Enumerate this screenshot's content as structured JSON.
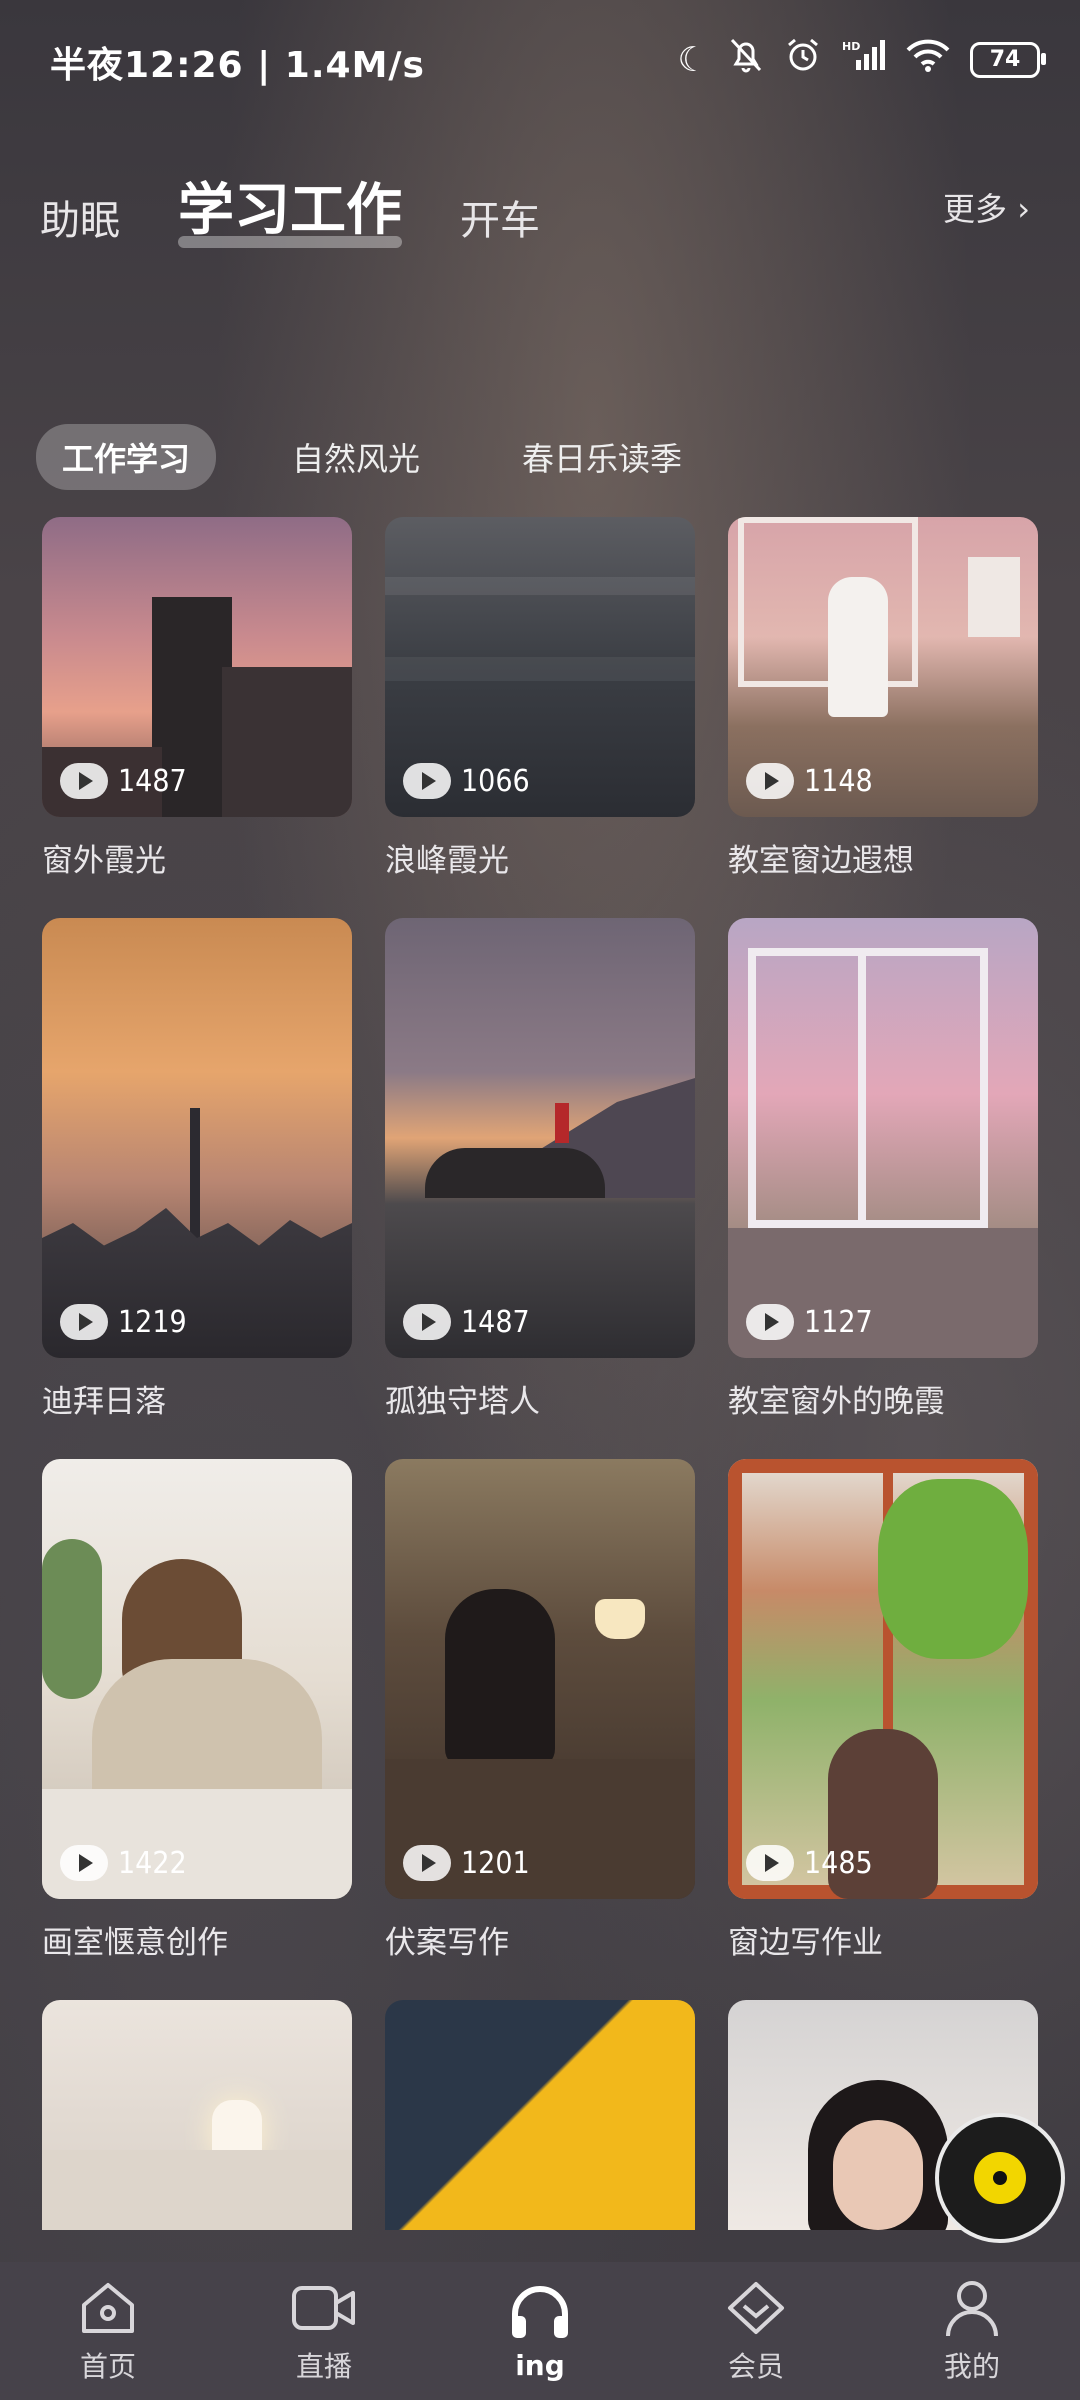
{
  "status_bar": {
    "time": "半夜12:26 | 1.4M/s",
    "battery": "74",
    "icons": [
      "moon-icon",
      "bell-off-icon",
      "alarm-icon",
      "signal-icon",
      "wifi-icon",
      "battery-icon"
    ]
  },
  "top_tabs": [
    {
      "label": "助眠"
    },
    {
      "label": "学习工作"
    },
    {
      "label": "开车"
    }
  ],
  "more_label": "更多",
  "sub_tabs": [
    {
      "label": "工作学习"
    },
    {
      "label": "自然风光"
    },
    {
      "label": "春日乐读季"
    }
  ],
  "cards": [
    {
      "title": "窗外霞光",
      "plays": "1487"
    },
    {
      "title": "浪峰霞光",
      "plays": "1066"
    },
    {
      "title": "教室窗边遐想",
      "plays": "1148"
    },
    {
      "title": "迪拜日落",
      "plays": "1219"
    },
    {
      "title": "孤独守塔人",
      "plays": "1487"
    },
    {
      "title": "教室窗外的晚霞",
      "plays": "1127"
    },
    {
      "title": "画室惬意创作",
      "plays": "1422"
    },
    {
      "title": "伏案写作",
      "plays": "1201"
    },
    {
      "title": "窗边写作业",
      "plays": "1485"
    }
  ],
  "bottom_nav": [
    {
      "label": "首页",
      "icon": "home-icon"
    },
    {
      "label": "直播",
      "icon": "video-camera-icon"
    },
    {
      "label": "ing",
      "icon": "headphones-icon"
    },
    {
      "label": "会员",
      "icon": "diamond-icon"
    },
    {
      "label": "我的",
      "icon": "user-icon"
    }
  ]
}
